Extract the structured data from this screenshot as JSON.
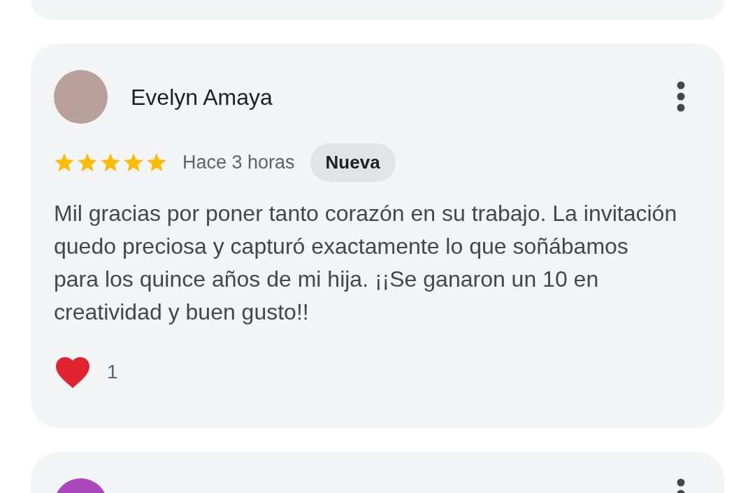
{
  "reviews": [
    {
      "author": "Evelyn Amaya",
      "stars": 5,
      "time": "Hace 3 horas",
      "badge": "Nueva",
      "text": "Mil gracias por poner tanto corazón en su trabajo. La invitación quedo preciosa y capturó exactamente lo que soñábamos para los quince años de mi hija. ¡¡Se ganaron un 10 en creatividad y buen gusto!!",
      "reactions": "1"
    }
  ],
  "next_review": {
    "color": "#ab47bc"
  }
}
